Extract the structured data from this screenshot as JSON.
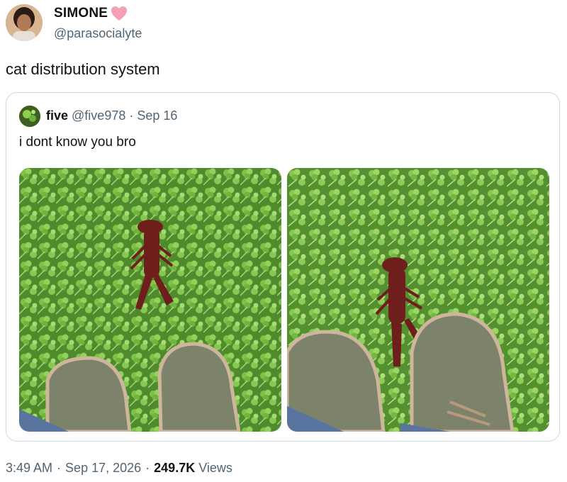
{
  "author": {
    "display_name": "SIMONE",
    "handle": "@parasocialyte",
    "badge_icon": "heart-icon",
    "badge_color": "#f4a0b6"
  },
  "tweet": {
    "text": "cat distribution system"
  },
  "quoted": {
    "display_name": "five",
    "handle": "@five978",
    "separator": "·",
    "date": "Sep 16",
    "text": "i dont know you bro",
    "photos": [
      {
        "name": "crayfish-photo-1",
        "subject": "crayfish on clover next to two olive sneakers"
      },
      {
        "name": "crayfish-photo-2",
        "subject": "crayfish walking toward sneakers on clover"
      }
    ]
  },
  "meta": {
    "time": "3:49 AM",
    "separator": "·",
    "date": "Sep 17, 2026",
    "views_count": "249.7K",
    "views_label": "Views"
  },
  "colors": {
    "text": "#0f1419",
    "secondary": "#536471",
    "border": "#cfd9de",
    "grass": "#5d9a35",
    "crayfish": "#6e1f1c",
    "shoe": "#7d836a"
  }
}
